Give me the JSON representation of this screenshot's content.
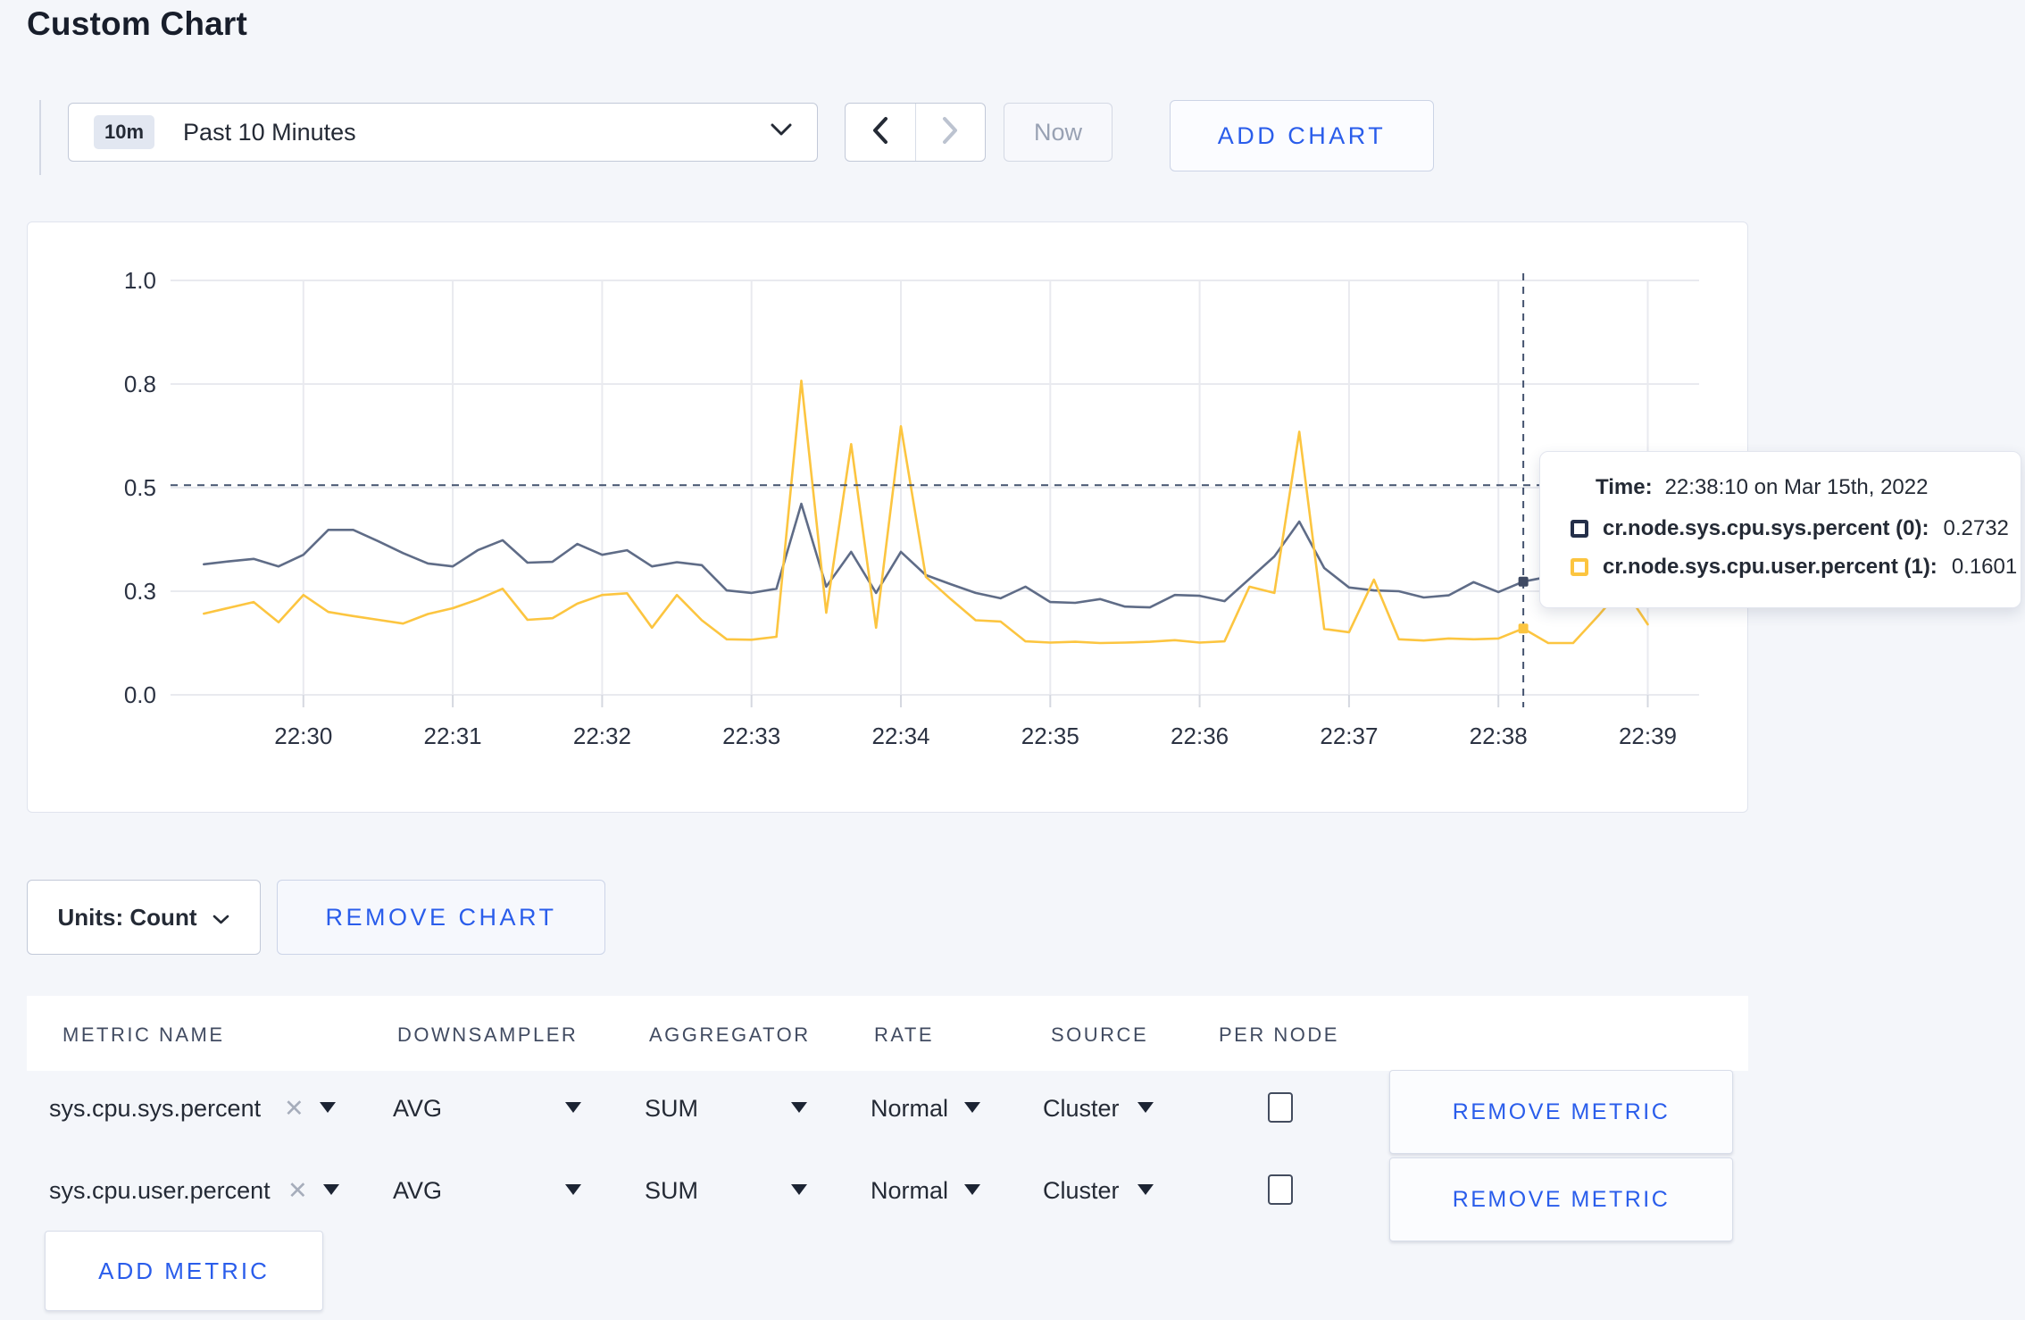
{
  "page": {
    "title": "Custom Chart"
  },
  "toolbar": {
    "range_badge": "10m",
    "range_label": "Past 10 Minutes",
    "now_label": "Now",
    "add_chart_label": "ADD CHART"
  },
  "chart_controls": {
    "units_label": "Units: Count",
    "remove_chart_label": "REMOVE CHART"
  },
  "tooltip": {
    "time_label": "Time:",
    "time_value": "22:38:10 on Mar 15th, 2022",
    "rows": [
      {
        "name": "cr.node.sys.cpu.sys.percent (0):",
        "value": "0.2732",
        "swatch_color": "#242f49"
      },
      {
        "name": "cr.node.sys.cpu.user.percent (1):",
        "value": "0.1601",
        "swatch_color": "#fcc540"
      }
    ]
  },
  "chart_data": {
    "type": "line",
    "title": "",
    "xlabel": "",
    "ylabel": "",
    "ylim": [
      0,
      1
    ],
    "grid": true,
    "y_tick_values": [
      0,
      0.25,
      0.5,
      0.75,
      1.0
    ],
    "y_tick_labels": [
      "0.0",
      "0.3",
      "0.5",
      "0.8",
      "1.0"
    ],
    "x_tick_labels": [
      "22:30",
      "22:31",
      "22:32",
      "22:33",
      "22:34",
      "22:35",
      "22:36",
      "22:37",
      "22:38",
      "22:39"
    ],
    "start_time": "22:29:20",
    "interval_seconds": 10,
    "end_time": "22:39:00",
    "series": [
      {
        "name": "cr.node.sys.cpu.sys.percent (0)",
        "color": "#5f6c87",
        "values": [
          0.315,
          0.322,
          0.328,
          0.31,
          0.338,
          0.398,
          0.398,
          0.371,
          0.342,
          0.317,
          0.31,
          0.349,
          0.373,
          0.319,
          0.321,
          0.364,
          0.338,
          0.349,
          0.31,
          0.32,
          0.313,
          0.252,
          0.246,
          0.256,
          0.461,
          0.261,
          0.345,
          0.246,
          0.345,
          0.289,
          0.267,
          0.246,
          0.233,
          0.261,
          0.224,
          0.222,
          0.231,
          0.213,
          0.211,
          0.241,
          0.239,
          0.226,
          0.28,
          0.334,
          0.418,
          0.306,
          0.259,
          0.252,
          0.25,
          0.235,
          0.24,
          0.272,
          0.248,
          0.2732,
          0.285,
          0.295,
          0.3,
          0.3,
          0.305
        ]
      },
      {
        "name": "cr.node.sys.cpu.user.percent (1)",
        "color": "#fcc540",
        "values": [
          0.196,
          0.21,
          0.224,
          0.175,
          0.241,
          0.2,
          0.19,
          0.181,
          0.172,
          0.195,
          0.209,
          0.23,
          0.256,
          0.181,
          0.185,
          0.22,
          0.241,
          0.245,
          0.162,
          0.241,
          0.18,
          0.134,
          0.133,
          0.14,
          0.758,
          0.198,
          0.605,
          0.162,
          0.648,
          0.285,
          0.231,
          0.18,
          0.177,
          0.129,
          0.126,
          0.128,
          0.125,
          0.126,
          0.128,
          0.132,
          0.126,
          0.129,
          0.261,
          0.246,
          0.635,
          0.159,
          0.151,
          0.278,
          0.134,
          0.131,
          0.136,
          0.134,
          0.136,
          0.1601,
          0.125,
          0.125,
          0.19,
          0.26,
          0.17
        ]
      }
    ],
    "crosshair": {
      "time": "22:38:10",
      "point_index": 53,
      "hover_value": 0.506,
      "highlight_values": [
        0.2732,
        0.1601
      ]
    },
    "legend_position": "tooltip",
    "colors": {
      "grid": "#e9eaef",
      "crosshair": "#44536f",
      "axis_text": "#2b3242"
    }
  },
  "metrics_table": {
    "headers": [
      "METRIC NAME",
      "DOWNSAMPLER",
      "AGGREGATOR",
      "RATE",
      "SOURCE",
      "PER NODE"
    ],
    "close_icon": "✕",
    "rows": [
      {
        "metric": "sys.cpu.sys.percent",
        "downsampler": "AVG",
        "aggregator": "SUM",
        "rate": "Normal",
        "source": "Cluster",
        "per_node_checked": false,
        "remove_label": "REMOVE METRIC"
      },
      {
        "metric": "sys.cpu.user.percent",
        "downsampler": "AVG",
        "aggregator": "SUM",
        "rate": "Normal",
        "source": "Cluster",
        "per_node_checked": false,
        "remove_label": "REMOVE METRIC"
      }
    ],
    "add_metric_label": "ADD METRIC"
  }
}
